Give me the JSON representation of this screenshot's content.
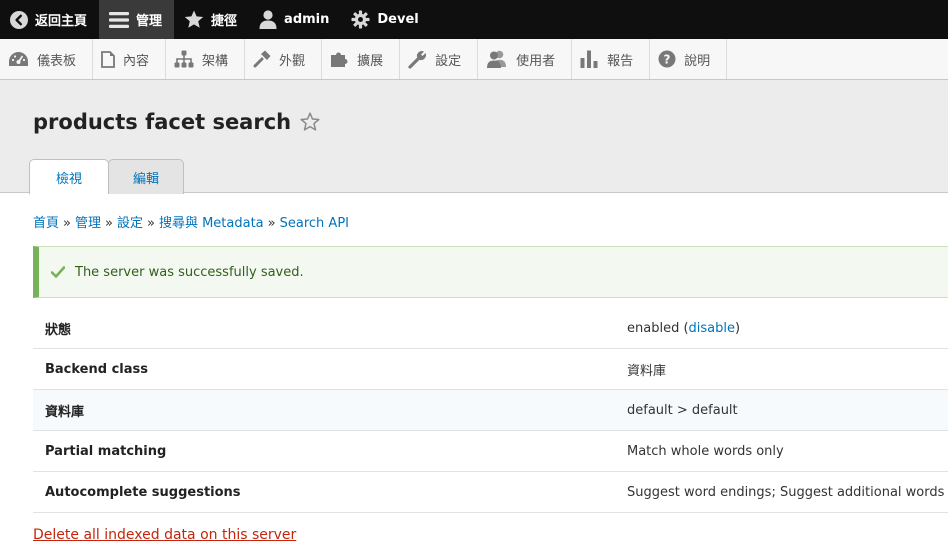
{
  "toolbar": {
    "back": "返回主頁",
    "manage": "管理",
    "shortcuts": "捷徑",
    "user": "admin",
    "devel": "Devel"
  },
  "tray": {
    "items": [
      {
        "label": "儀表板",
        "icon": "dashboard-icon"
      },
      {
        "label": "內容",
        "icon": "content-icon"
      },
      {
        "label": "架構",
        "icon": "structure-icon"
      },
      {
        "label": "外觀",
        "icon": "appearance-icon"
      },
      {
        "label": "擴展",
        "icon": "extend-icon"
      },
      {
        "label": "設定",
        "icon": "config-icon"
      },
      {
        "label": "使用者",
        "icon": "people-icon"
      },
      {
        "label": "報告",
        "icon": "reports-icon"
      },
      {
        "label": "說明",
        "icon": "help-icon"
      }
    ]
  },
  "page": {
    "title": "products facet search",
    "tabs": [
      {
        "label": "檢視",
        "active": true
      },
      {
        "label": "編輯",
        "active": false
      }
    ]
  },
  "breadcrumb": {
    "items": [
      "首頁",
      "管理",
      "設定",
      "搜尋與 Metadata",
      "Search API"
    ],
    "separator": "»"
  },
  "message": {
    "text": "The server was successfully saved."
  },
  "details": {
    "status_label": "狀態",
    "status_value_prefix": "enabled (",
    "status_link": "disable",
    "status_value_suffix": ")",
    "rows": [
      {
        "label": "Backend class",
        "value": "資料庫"
      },
      {
        "label": "資料庫",
        "value": "default > default"
      },
      {
        "label": "Partial matching",
        "value": "Match whole words only"
      },
      {
        "label": "Autocomplete suggestions",
        "value": "Suggest word endings; Suggest additional words"
      }
    ]
  },
  "actions": {
    "delete_link": "Delete all indexed data on this server"
  },
  "colors": {
    "link": "#0074bd",
    "success_bar": "#77b259",
    "danger_link": "#c4250c"
  }
}
